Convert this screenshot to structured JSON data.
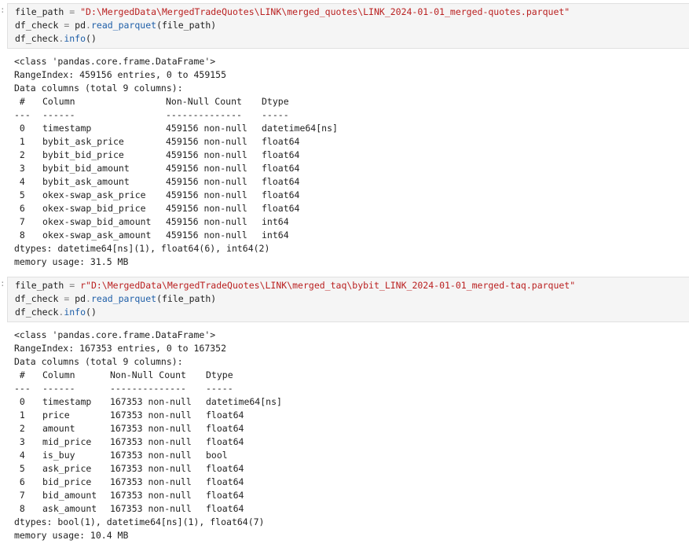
{
  "cells": [
    {
      "prompt": ":",
      "code": {
        "line1": {
          "var": "file_path",
          "op": " = ",
          "str_prefix": "",
          "str": "\"D:\\MergedData\\MergedTradeQuotes\\LINK\\merged_quotes\\LINK_2024-01-01_merged-quotes.parquet\""
        },
        "line2": {
          "var": "df_check",
          "op": " = ",
          "obj": "pd",
          "dot": ".",
          "fn": "read_parquet",
          "args": "(file_path)"
        },
        "line3": {
          "var": "df_check",
          "dot": ".",
          "fn": "info",
          "args": "()"
        }
      },
      "output": {
        "class_line": "<class 'pandas.core.frame.DataFrame'>",
        "range_line": "RangeIndex: 459156 entries, 0 to 459155",
        "columns_line": "Data columns (total 9 columns):",
        "header": {
          "idx": " #",
          "column": "Column",
          "count": "Non-Null Count",
          "dtype": "Dtype"
        },
        "divider": {
          "idx": "---",
          "column": "------",
          "count": "--------------",
          "dtype": "-----"
        },
        "rows": [
          {
            "idx": " 0",
            "column": "timestamp",
            "count": "459156 non-null",
            "dtype": "datetime64[ns]"
          },
          {
            "idx": " 1",
            "column": "bybit_ask_price",
            "count": "459156 non-null",
            "dtype": "float64"
          },
          {
            "idx": " 2",
            "column": "bybit_bid_price",
            "count": "459156 non-null",
            "dtype": "float64"
          },
          {
            "idx": " 3",
            "column": "bybit_bid_amount",
            "count": "459156 non-null",
            "dtype": "float64"
          },
          {
            "idx": " 4",
            "column": "bybit_ask_amount",
            "count": "459156 non-null",
            "dtype": "float64"
          },
          {
            "idx": " 5",
            "column": "okex-swap_ask_price",
            "count": "459156 non-null",
            "dtype": "float64"
          },
          {
            "idx": " 6",
            "column": "okex-swap_bid_price",
            "count": "459156 non-null",
            "dtype": "float64"
          },
          {
            "idx": " 7",
            "column": "okex-swap_bid_amount",
            "count": "459156 non-null",
            "dtype": "int64"
          },
          {
            "idx": " 8",
            "column": "okex-swap_ask_amount",
            "count": "459156 non-null",
            "dtype": "int64"
          }
        ],
        "dtypes_line": "dtypes: datetime64[ns](1), float64(6), int64(2)",
        "memory_line": "memory usage: 31.5 MB"
      }
    },
    {
      "prompt": ":",
      "code": {
        "line1": {
          "var": "file_path",
          "op": " = ",
          "str_prefix": "r",
          "str": "\"D:\\MergedData\\MergedTradeQuotes\\LINK\\merged_taq\\bybit_LINK_2024-01-01_merged-taq.parquet\""
        },
        "line2": {
          "var": "df_check",
          "op": " = ",
          "obj": "pd",
          "dot": ".",
          "fn": "read_parquet",
          "args": "(file_path)"
        },
        "line3": {
          "var": "df_check",
          "dot": ".",
          "fn": "info",
          "args": "()"
        }
      },
      "output": {
        "class_line": "<class 'pandas.core.frame.DataFrame'>",
        "range_line": "RangeIndex: 167353 entries, 0 to 167352",
        "columns_line": "Data columns (total 9 columns):",
        "header": {
          "idx": " #",
          "column": "Column",
          "count": "Non-Null Count",
          "dtype": "Dtype"
        },
        "divider": {
          "idx": "---",
          "column": "------",
          "count": "--------------",
          "dtype": "-----"
        },
        "rows": [
          {
            "idx": " 0",
            "column": "timestamp",
            "count": "167353 non-null",
            "dtype": "datetime64[ns]"
          },
          {
            "idx": " 1",
            "column": "price",
            "count": "167353 non-null",
            "dtype": "float64"
          },
          {
            "idx": " 2",
            "column": "amount",
            "count": "167353 non-null",
            "dtype": "float64"
          },
          {
            "idx": " 3",
            "column": "mid_price",
            "count": "167353 non-null",
            "dtype": "float64"
          },
          {
            "idx": " 4",
            "column": "is_buy",
            "count": "167353 non-null",
            "dtype": "bool"
          },
          {
            "idx": " 5",
            "column": "ask_price",
            "count": "167353 non-null",
            "dtype": "float64"
          },
          {
            "idx": " 6",
            "column": "bid_price",
            "count": "167353 non-null",
            "dtype": "float64"
          },
          {
            "idx": " 7",
            "column": "bid_amount",
            "count": "167353 non-null",
            "dtype": "float64"
          },
          {
            "idx": " 8",
            "column": "ask_amount",
            "count": "167353 non-null",
            "dtype": "float64"
          }
        ],
        "dtypes_line": "dtypes: bool(1), datetime64[ns](1), float64(7)",
        "memory_line": "memory usage: 10.4 MB"
      }
    }
  ]
}
